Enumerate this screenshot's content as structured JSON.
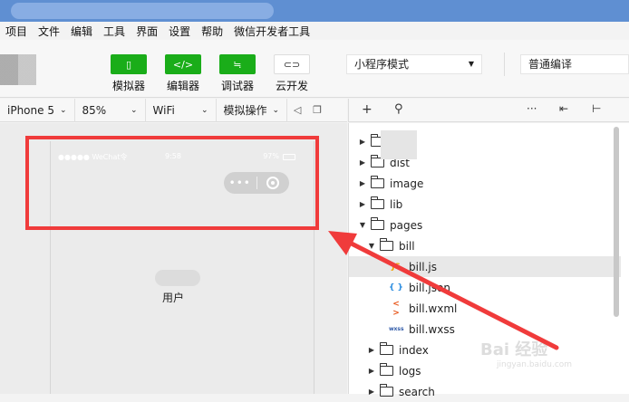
{
  "menu": [
    "项目",
    "文件",
    "编辑",
    "工具",
    "界面",
    "设置",
    "帮助",
    "微信开发者工具"
  ],
  "toolbar": {
    "simulator_label": "模拟器",
    "editor_label": "编辑器",
    "debugger_label": "调试器",
    "cloud_label": "云开发",
    "mode": "小程序模式",
    "compile": "普通编译",
    "accent_color": "#1aad19"
  },
  "simbar": {
    "device": "iPhone 5",
    "zoom": "85%",
    "network": "WiFi",
    "action": "模拟操作"
  },
  "phone": {
    "carrier": "●●●●● WeChat令",
    "time": "9:58",
    "battery": "97%",
    "page_text": "用户"
  },
  "filetree": {
    "items": [
      {
        "label": "",
        "type": "folder",
        "expand": "▶"
      },
      {
        "label": "dist",
        "type": "folder",
        "expand": "▶"
      },
      {
        "label": "image",
        "type": "folder",
        "expand": "▶"
      },
      {
        "label": "lib",
        "type": "folder",
        "expand": "▶"
      },
      {
        "label": "pages",
        "type": "folder",
        "expand": "▼"
      },
      {
        "label": "bill",
        "type": "folder",
        "expand": "▼"
      },
      {
        "label": "bill.js",
        "type": "js",
        "icon": "JS"
      },
      {
        "label": "bill.json",
        "type": "json",
        "icon": "{ }"
      },
      {
        "label": "bill.wxml",
        "type": "wxml",
        "icon": "< >"
      },
      {
        "label": "bill.wxss",
        "type": "wxss",
        "icon": "wxss"
      },
      {
        "label": "index",
        "type": "folder",
        "expand": "▶"
      },
      {
        "label": "logs",
        "type": "folder",
        "expand": "▶"
      },
      {
        "label": "search",
        "type": "folder",
        "expand": "▶"
      }
    ]
  },
  "watermark": {
    "brand": "Bai 经验",
    "url": "jingyan.baidu.com"
  }
}
